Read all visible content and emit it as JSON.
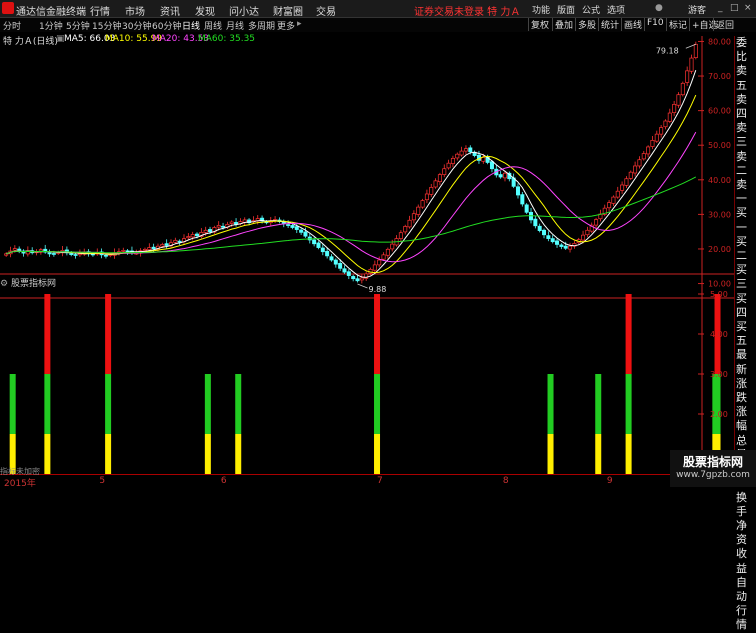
{
  "titlebar": {
    "app_name": "通达信金融终端",
    "menus": [
      "行情",
      "市场",
      "资讯",
      "发现",
      "问小达",
      "财富圈",
      "交易"
    ],
    "center_title": "证券交易未登录  特 力Ａ",
    "right_menus": [
      "功能",
      "版面",
      "公式",
      "选项"
    ],
    "guest": "游客"
  },
  "toolbar": {
    "timeframes": [
      "分时",
      "1分钟",
      "5分钟",
      "15分钟",
      "30分钟",
      "60分钟",
      "日线",
      "周线",
      "月线",
      "多周期",
      "更多"
    ],
    "active": "日线",
    "right_tools": [
      "复权",
      "叠加",
      "多股",
      "统计",
      "画线",
      "F10",
      "标记",
      "+自选",
      "返回"
    ]
  },
  "infobar": {
    "stock": "特 力Ａ(日线)",
    "ma5_label": "MA5: 66.03",
    "ma10_label": "MA10: 55.99",
    "ma20_label": "MA20: 43.53",
    "ma60_label": "MA60: 35.35"
  },
  "colors": {
    "up": "#ff3333",
    "down": "#54ffff",
    "ma5": "#ffffff",
    "ma10": "#ffff00",
    "ma20": "#ff44ff",
    "ma60": "#22dd22",
    "axis": "#c22"
  },
  "price_axis": {
    "ticks": [
      "80.00",
      "70.00",
      "60.00",
      "50.00",
      "40.00",
      "30.00",
      "20.00",
      "10.00"
    ],
    "tick_values": [
      80,
      70,
      60,
      50,
      40,
      30,
      20,
      10
    ],
    "range": [
      6.4,
      81
    ],
    "high_label": "79.18",
    "low_label": "9.88",
    "high_value": 79.18,
    "low_value": 9.88
  },
  "indicator": {
    "title": "股票指标网",
    "ticks": [
      "5.00",
      "4.00",
      "3.00",
      "2.00",
      "1.00"
    ],
    "tick_values": [
      5,
      4,
      3,
      2,
      1
    ],
    "range": [
      0.5,
      5.3
    ],
    "signals": [
      {
        "bar": 2,
        "level": 3
      },
      {
        "bar": 10,
        "level": 5
      },
      {
        "bar": 24,
        "level": 5
      },
      {
        "bar": 47,
        "level": 3
      },
      {
        "bar": 54,
        "level": 3
      },
      {
        "bar": 86,
        "level": 5
      },
      {
        "bar": 126,
        "level": 3
      },
      {
        "bar": 137,
        "level": 3
      },
      {
        "bar": 144,
        "level": 5
      },
      {
        "bar": 164,
        "level": 3
      },
      {
        "bar": 164.5,
        "level": 5
      }
    ],
    "bottom_note": "指标未加密"
  },
  "sidebar": [
    "委比",
    "卖五",
    "卖四",
    "卖三",
    "卖二",
    "卖一",
    "买一",
    "买二",
    "买三",
    "买四",
    "买五",
    "最新",
    "涨跌",
    "涨幅",
    "总量",
    "外盘",
    "换手",
    "净资",
    "收益",
    "",
    "",
    "自动",
    "行情"
  ],
  "date_axis": [
    {
      "label": "2015年",
      "bar": 0
    },
    {
      "label": "5",
      "bar": 22
    },
    {
      "label": "6",
      "bar": 50
    },
    {
      "label": "7",
      "bar": 86
    },
    {
      "label": "8",
      "bar": 115
    },
    {
      "label": "9",
      "bar": 139
    },
    {
      "label": "1",
      "bar": 161
    }
  ],
  "watermark": {
    "title": "股票指标网",
    "url": "www.7gpzb.com"
  },
  "chart_data": {
    "type": "candlestick",
    "closes": [
      18.6,
      19.4,
      20.1,
      19.3,
      18.8,
      19.5,
      18.9,
      19.2,
      19.8,
      19.1,
      18.7,
      18.5,
      19.0,
      19.6,
      18.9,
      18.4,
      18.2,
      18.6,
      19.1,
      18.8,
      18.5,
      18.9,
      18.3,
      18.0,
      18.4,
      18.9,
      19.2,
      19.6,
      19.3,
      19.0,
      18.8,
      19.5,
      19.9,
      20.4,
      20.1,
      20.8,
      21.3,
      21.0,
      21.8,
      22.5,
      22.1,
      23.0,
      23.6,
      24.2,
      23.8,
      24.8,
      25.4,
      25.0,
      26.2,
      26.8,
      26.3,
      27.1,
      27.8,
      27.2,
      27.9,
      28.4,
      27.6,
      28.2,
      28.8,
      28.1,
      27.6,
      28.0,
      28.5,
      27.9,
      27.3,
      26.8,
      26.2,
      25.6,
      24.8,
      23.7,
      22.6,
      21.5,
      20.4,
      19.2,
      18.0,
      16.8,
      15.6,
      14.4,
      13.3,
      12.3,
      11.4,
      10.8,
      11.6,
      12.8,
      14.1,
      15.4,
      16.8,
      18.3,
      19.9,
      21.4,
      23.0,
      24.7,
      26.5,
      28.3,
      30.2,
      32.1,
      34.0,
      35.9,
      37.8,
      39.7,
      41.5,
      43.2,
      44.8,
      46.2,
      47.4,
      48.3,
      49.0,
      48.1,
      47.0,
      45.6,
      46.5,
      45.0,
      43.2,
      41.4,
      40.8,
      41.9,
      40.3,
      38.1,
      35.6,
      33.0,
      30.6,
      28.4,
      26.7,
      25.3,
      24.1,
      23.0,
      22.1,
      21.3,
      20.7,
      20.2,
      20.8,
      21.6,
      22.7,
      24.0,
      25.4,
      26.9,
      28.5,
      30.1,
      31.8,
      33.4,
      35.0,
      36.7,
      38.5,
      40.3,
      42.2,
      44.0,
      45.8,
      47.6,
      49.5,
      51.4,
      53.2,
      55.1,
      57.0,
      59.3,
      61.8,
      64.6,
      67.9,
      71.5,
      75.2,
      79.18
    ],
    "ma_series": [
      "MA5",
      "MA10",
      "MA20",
      "MA60"
    ]
  }
}
